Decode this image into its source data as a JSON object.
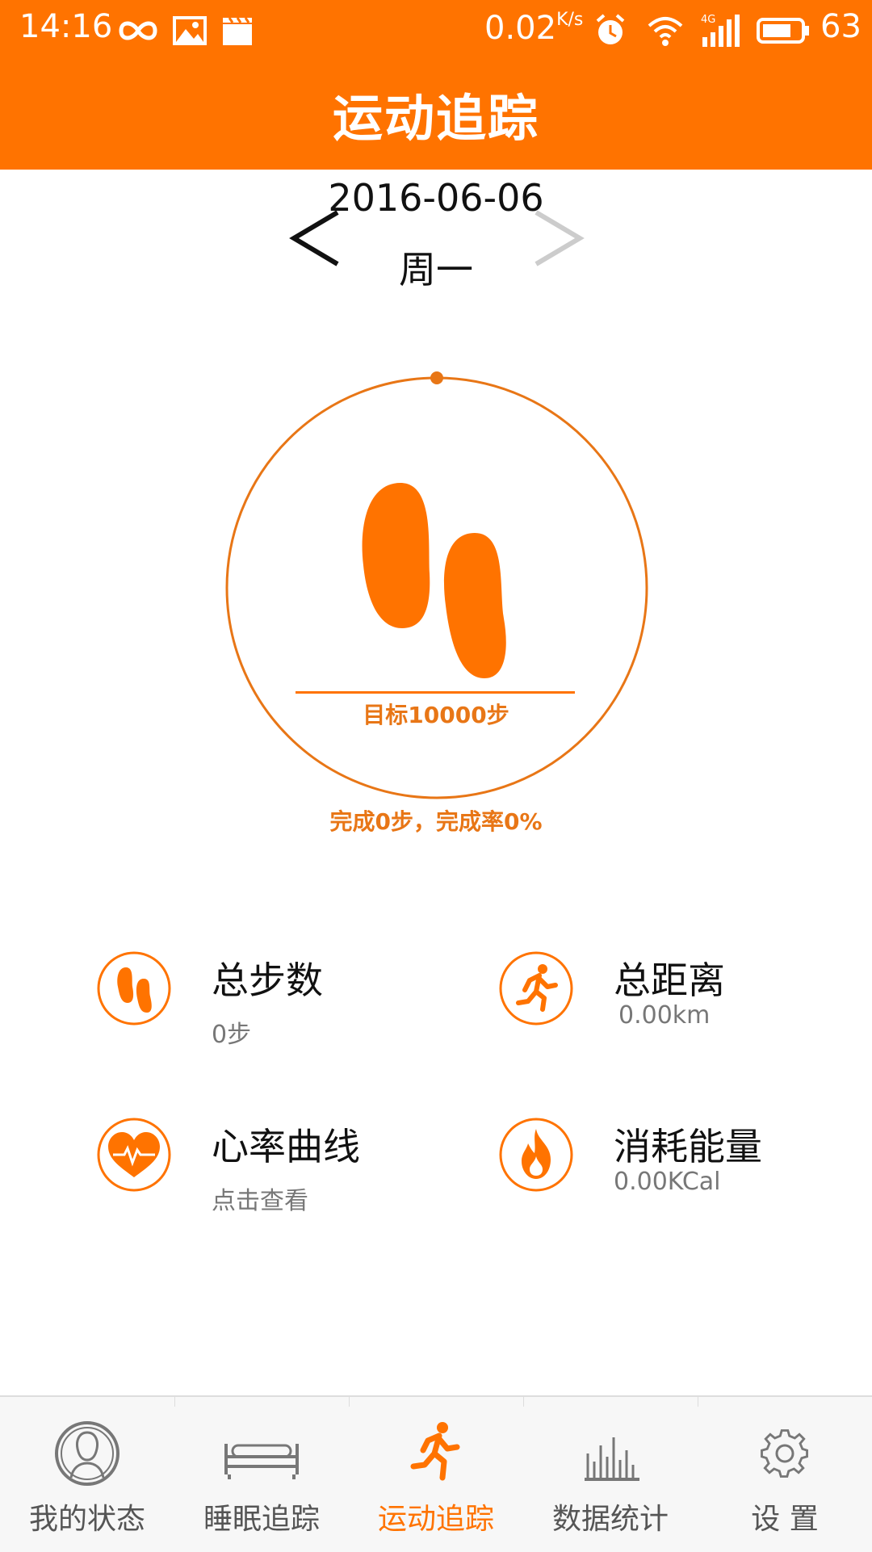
{
  "status_bar": {
    "time": "14:16",
    "speed": "0.02",
    "speed_unit": "K/s",
    "network": "4G",
    "battery": "63"
  },
  "header": {
    "title": "运动追踪"
  },
  "date_nav": {
    "date": "2016-06-06",
    "weekday": "周一",
    "prev_icon": "chevron-left-icon",
    "next_icon": "chevron-right-icon"
  },
  "progress": {
    "goal_text": "目标10000步",
    "completion_text": "完成0步，完成率0%",
    "steps_done": 0,
    "goal_steps": 10000,
    "completion_fraction": 0.0
  },
  "stats": [
    {
      "icon": "footprints-icon",
      "label": "总步数",
      "value": "0步"
    },
    {
      "icon": "running-icon",
      "label": "总距离",
      "value": "0.00km"
    },
    {
      "icon": "heart-rate-icon",
      "label": "心率曲线",
      "value": "点击查看"
    },
    {
      "icon": "flame-icon",
      "label": "消耗能量",
      "value": "0.00KCal"
    }
  ],
  "tabs": [
    {
      "icon": "person-icon",
      "label": "我的状态",
      "active": false
    },
    {
      "icon": "bed-icon",
      "label": "睡眠追踪",
      "active": false
    },
    {
      "icon": "running-icon",
      "label": "运动追踪",
      "active": true
    },
    {
      "icon": "bar-chart-icon",
      "label": "数据统计",
      "active": false
    },
    {
      "icon": "gear-icon",
      "label": "设 置",
      "active": false
    }
  ],
  "colors": {
    "accent": "#FF7300",
    "accent_text": "#E87616",
    "inactive_tab": "#555555",
    "next_arrow_disabled": "#CCCCCC"
  }
}
